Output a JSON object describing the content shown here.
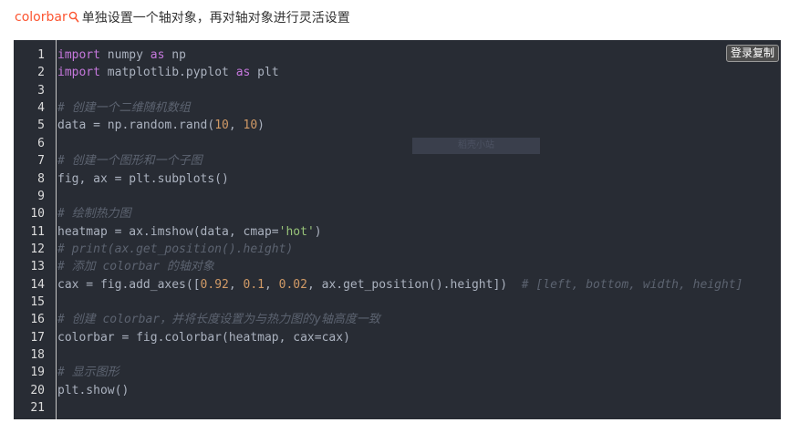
{
  "header": {
    "keyword": "colorbar",
    "search_icon": "search-icon",
    "text": "单独设置一个轴对象，再对轴对象进行灵活设置"
  },
  "code_block": {
    "copy_button": "登录复制",
    "watermark": "稻壳小站",
    "line_numbers": [
      "1",
      "2",
      "3",
      "4",
      "5",
      "6",
      "7",
      "8",
      "9",
      "10",
      "11",
      "12",
      "13",
      "14",
      "15",
      "16",
      "17",
      "18",
      "19",
      "20",
      "21"
    ],
    "lines": [
      [
        {
          "t": "import",
          "c": "kw"
        },
        {
          "t": " numpy "
        },
        {
          "t": "as",
          "c": "kw"
        },
        {
          "t": " np"
        }
      ],
      [
        {
          "t": "import",
          "c": "kw"
        },
        {
          "t": " matplotlib.pyplot "
        },
        {
          "t": "as",
          "c": "kw"
        },
        {
          "t": " plt"
        }
      ],
      [],
      [
        {
          "t": "# 创建一个二维随机数组",
          "c": "cm"
        }
      ],
      [
        {
          "t": "data = np.random.rand("
        },
        {
          "t": "10",
          "c": "nm"
        },
        {
          "t": ", "
        },
        {
          "t": "10",
          "c": "nm"
        },
        {
          "t": ")"
        }
      ],
      [],
      [
        {
          "t": "# 创建一个图形和一个子图",
          "c": "cm"
        }
      ],
      [
        {
          "t": "fig, ax = plt.subplots()"
        }
      ],
      [],
      [
        {
          "t": "# 绘制热力图",
          "c": "cm"
        }
      ],
      [
        {
          "t": "heatmap = ax.imshow(data, cmap="
        },
        {
          "t": "'hot'",
          "c": "st"
        },
        {
          "t": ")"
        }
      ],
      [
        {
          "t": "# print(ax.get_position().height)",
          "c": "cm"
        }
      ],
      [
        {
          "t": "# 添加 colorbar 的轴对象",
          "c": "cm"
        }
      ],
      [
        {
          "t": "cax = fig.add_axes(["
        },
        {
          "t": "0.92",
          "c": "nm"
        },
        {
          "t": ", "
        },
        {
          "t": "0.1",
          "c": "nm"
        },
        {
          "t": ", "
        },
        {
          "t": "0.02",
          "c": "nm"
        },
        {
          "t": ", ax.get_position().height])  "
        },
        {
          "t": "# [left, bottom, width, height]",
          "c": "cm"
        }
      ],
      [],
      [
        {
          "t": "# 创建 colorbar，并将长度设置为与热力图的y轴高度一致",
          "c": "cm"
        }
      ],
      [
        {
          "t": "colorbar = fig.colorbar(heatmap, cax=cax)"
        }
      ],
      [],
      [
        {
          "t": "# 显示图形",
          "c": "cm"
        }
      ],
      [
        {
          "t": "plt.show()"
        }
      ],
      []
    ]
  }
}
